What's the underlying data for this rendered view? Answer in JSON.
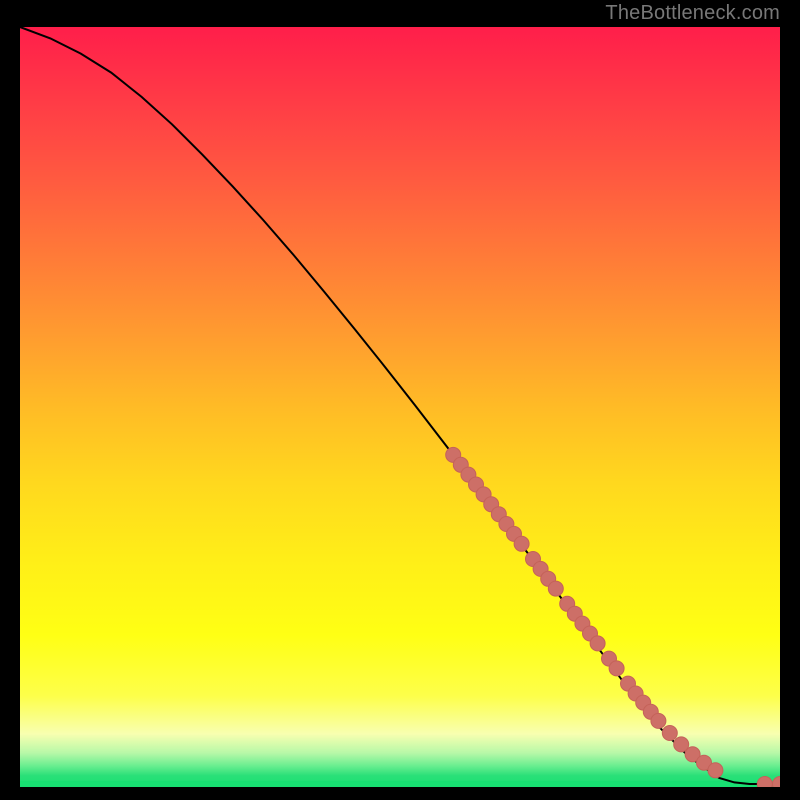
{
  "watermark": "TheBottleneck.com",
  "colors": {
    "black": "#000000",
    "green": "#18E072",
    "line": "#000000",
    "marker_fill": "#CD6F67",
    "marker_stroke": "#C46259",
    "watermark": "#787878"
  },
  "chart_data": {
    "type": "line",
    "title": "",
    "xlabel": "",
    "ylabel": "",
    "xlim": [
      0,
      100
    ],
    "ylim": [
      0,
      100
    ],
    "background": "rainbow-gradient-vertical",
    "series": [
      {
        "name": "bottleneck-curve",
        "x": [
          0,
          4,
          8,
          12,
          16,
          20,
          24,
          28,
          32,
          36,
          40,
          44,
          48,
          52,
          56,
          60,
          64,
          68,
          72,
          76,
          80,
          84,
          88,
          92,
          94,
          96,
          97,
          98,
          99,
          100
        ],
        "y": [
          100,
          98.5,
          96.5,
          94,
          90.8,
          87.2,
          83.2,
          79,
          74.6,
          70,
          65.2,
          60.3,
          55.3,
          50.2,
          45,
          39.8,
          34.5,
          29.2,
          23.8,
          18.4,
          13,
          8,
          4,
          1.2,
          0.6,
          0.4,
          0.4,
          0.4,
          0.4,
          0.4
        ]
      }
    ],
    "markers": [
      {
        "x": 57,
        "y": 43.7
      },
      {
        "x": 58,
        "y": 42.4
      },
      {
        "x": 59,
        "y": 41.1
      },
      {
        "x": 60,
        "y": 39.8
      },
      {
        "x": 61,
        "y": 38.5
      },
      {
        "x": 62,
        "y": 37.2
      },
      {
        "x": 63,
        "y": 35.9
      },
      {
        "x": 64,
        "y": 34.6
      },
      {
        "x": 65,
        "y": 33.3
      },
      {
        "x": 66,
        "y": 32.0
      },
      {
        "x": 67.5,
        "y": 30.0
      },
      {
        "x": 68.5,
        "y": 28.7
      },
      {
        "x": 69.5,
        "y": 27.4
      },
      {
        "x": 70.5,
        "y": 26.1
      },
      {
        "x": 72,
        "y": 24.1
      },
      {
        "x": 73,
        "y": 22.8
      },
      {
        "x": 74,
        "y": 21.5
      },
      {
        "x": 75,
        "y": 20.2
      },
      {
        "x": 76,
        "y": 18.9
      },
      {
        "x": 77.5,
        "y": 16.9
      },
      {
        "x": 78.5,
        "y": 15.6
      },
      {
        "x": 80,
        "y": 13.6
      },
      {
        "x": 81,
        "y": 12.3
      },
      {
        "x": 82,
        "y": 11.1
      },
      {
        "x": 83,
        "y": 9.9
      },
      {
        "x": 84,
        "y": 8.7
      },
      {
        "x": 85.5,
        "y": 7.1
      },
      {
        "x": 87,
        "y": 5.6
      },
      {
        "x": 88.5,
        "y": 4.3
      },
      {
        "x": 90,
        "y": 3.2
      },
      {
        "x": 91.5,
        "y": 2.2
      },
      {
        "x": 98,
        "y": 0.4
      },
      {
        "x": 100,
        "y": 0.4
      }
    ],
    "gradient_stops": [
      {
        "offset": 0.0,
        "color": "#FF1E4A"
      },
      {
        "offset": 0.1,
        "color": "#FF3C46"
      },
      {
        "offset": 0.2,
        "color": "#FF5A40"
      },
      {
        "offset": 0.3,
        "color": "#FF7A38"
      },
      {
        "offset": 0.4,
        "color": "#FF9A30"
      },
      {
        "offset": 0.5,
        "color": "#FFBB26"
      },
      {
        "offset": 0.6,
        "color": "#FFD81E"
      },
      {
        "offset": 0.7,
        "color": "#FFEE18"
      },
      {
        "offset": 0.8,
        "color": "#FFFF14"
      },
      {
        "offset": 0.88,
        "color": "#FDFF4A"
      },
      {
        "offset": 0.93,
        "color": "#F8FFB0"
      },
      {
        "offset": 0.955,
        "color": "#B8F8A8"
      },
      {
        "offset": 0.972,
        "color": "#6AEE90"
      },
      {
        "offset": 0.985,
        "color": "#2AE078"
      },
      {
        "offset": 1.0,
        "color": "#18E072"
      }
    ]
  }
}
